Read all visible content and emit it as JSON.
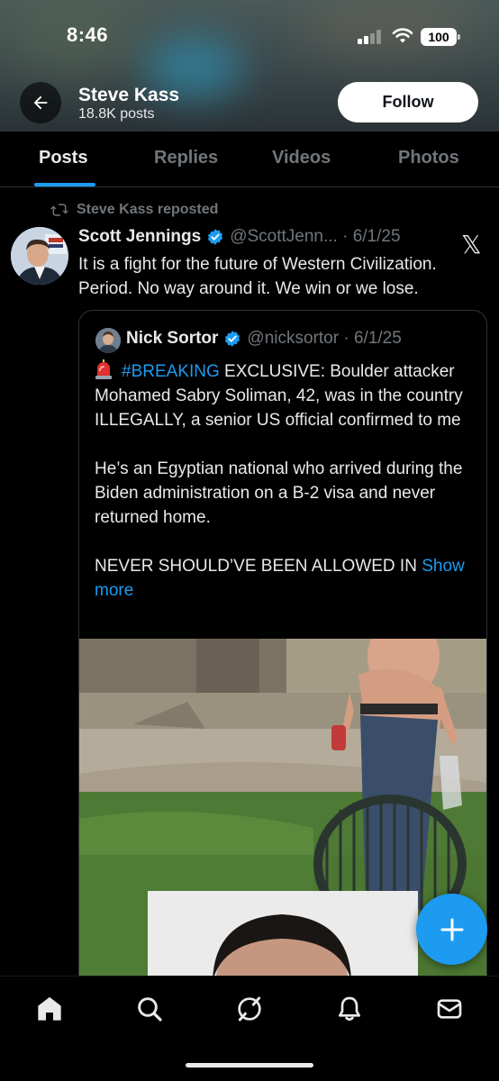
{
  "status_bar": {
    "time": "8:46",
    "battery": "100"
  },
  "header": {
    "name": "Steve Kass",
    "posts_count": "18.8K posts",
    "follow_label": "Follow",
    "back_icon": "arrow-left-icon"
  },
  "tabs": [
    {
      "label": "Posts",
      "active": true
    },
    {
      "label": "Replies",
      "active": false
    },
    {
      "label": "Videos",
      "active": false
    },
    {
      "label": "Photos",
      "active": false
    }
  ],
  "post": {
    "repost_label": "Steve Kass reposted",
    "author_name": "Scott Jennings",
    "author_handle": "@ScottJenn...",
    "date": "6/1/25",
    "text": "It is a fight for the future of Western Civilization. Period. No way around it. We win or we lose.",
    "source_icon": "x-logo-icon",
    "source_mark": "𝕏"
  },
  "quote": {
    "author_name": "Nick Sortor",
    "author_handle": "@nicksortor",
    "date": "6/1/25",
    "hashtag": "#BREAKING",
    "para1_rest": " EXCLUSIVE: Boulder attacker Mohamed Sabry Soliman, 42, was in the country ILLEGALLY, a senior US official confirmed to me",
    "para2": "He’s an Egyptian national who arrived during the Biden administration on a B-2 visa and never returned home.",
    "para3": "NEVER SHOULD’VE BEEN ALLOWED IN",
    "show_more": "Show more"
  },
  "nav": {
    "items": [
      "home-icon",
      "search-icon",
      "grok-icon",
      "notifications-icon",
      "messages-icon"
    ]
  },
  "colors": {
    "accent": "#1d9bf0",
    "background": "#000000",
    "muted": "#71767b",
    "text": "#e7e9ea"
  }
}
